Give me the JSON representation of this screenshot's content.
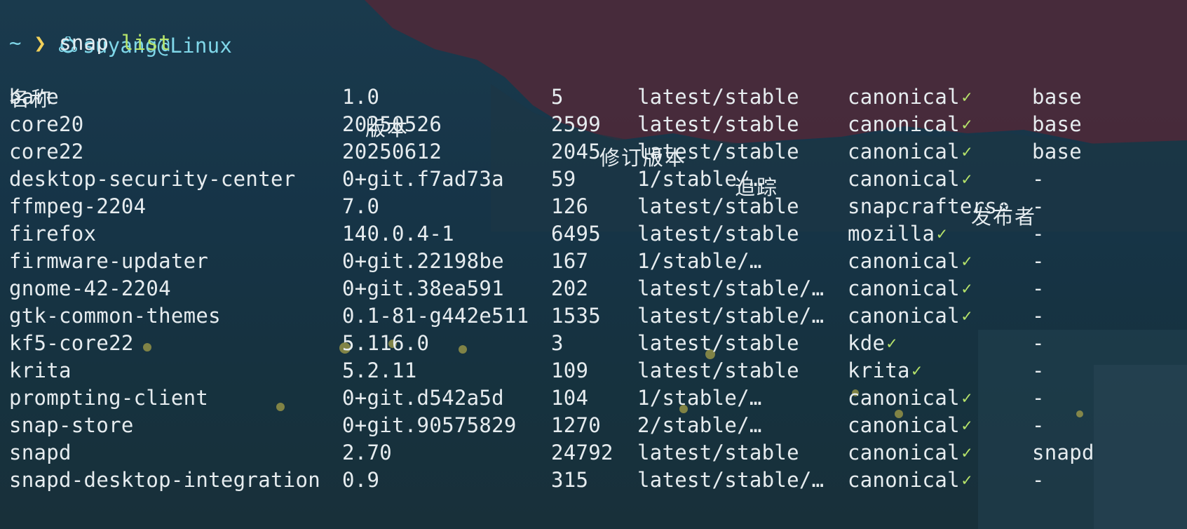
{
  "prompt": {
    "user_host": "suyang@Linux",
    "cwd": "~",
    "arrow": "❯",
    "command": "snap",
    "argument": "list"
  },
  "headers": [
    "名称",
    "版本",
    "修订版本",
    "追踪",
    "发布者"
  ],
  "rows": [
    {
      "name": "bare",
      "version": "1.0",
      "rev": "5",
      "tracking": "latest/stable",
      "publisher": "canonical",
      "badge": "✓",
      "notes": "base"
    },
    {
      "name": "core20",
      "version": "20250526",
      "rev": "2599",
      "tracking": "latest/stable",
      "publisher": "canonical",
      "badge": "✓",
      "notes": "base"
    },
    {
      "name": "core22",
      "version": "20250612",
      "rev": "2045",
      "tracking": "latest/stable",
      "publisher": "canonical",
      "badge": "✓",
      "notes": "base"
    },
    {
      "name": "desktop-security-center",
      "version": "0+git.f7ad73a",
      "rev": "59",
      "tracking": "1/stable/…",
      "publisher": "canonical",
      "badge": "✓",
      "notes": "-"
    },
    {
      "name": "ffmpeg-2204",
      "version": "7.0",
      "rev": "126",
      "tracking": "latest/stable",
      "publisher": "snapcrafters",
      "badge": "✪",
      "notes": "-"
    },
    {
      "name": "firefox",
      "version": "140.0.4-1",
      "rev": "6495",
      "tracking": "latest/stable",
      "publisher": "mozilla",
      "badge": "✓",
      "notes": "-"
    },
    {
      "name": "firmware-updater",
      "version": "0+git.22198be",
      "rev": "167",
      "tracking": "1/stable/…",
      "publisher": "canonical",
      "badge": "✓",
      "notes": "-"
    },
    {
      "name": "gnome-42-2204",
      "version": "0+git.38ea591",
      "rev": "202",
      "tracking": "latest/stable/…",
      "publisher": "canonical",
      "badge": "✓",
      "notes": "-"
    },
    {
      "name": "gtk-common-themes",
      "version": "0.1-81-g442e511",
      "rev": "1535",
      "tracking": "latest/stable/…",
      "publisher": "canonical",
      "badge": "✓",
      "notes": "-"
    },
    {
      "name": "kf5-core22",
      "version": "5.116.0",
      "rev": "3",
      "tracking": "latest/stable",
      "publisher": "kde",
      "badge": "✓",
      "notes": "-"
    },
    {
      "name": "krita",
      "version": "5.2.11",
      "rev": "109",
      "tracking": "latest/stable",
      "publisher": "krita",
      "badge": "✓",
      "notes": "-"
    },
    {
      "name": "prompting-client",
      "version": "0+git.d542a5d",
      "rev": "104",
      "tracking": "1/stable/…",
      "publisher": "canonical",
      "badge": "✓",
      "notes": "-"
    },
    {
      "name": "snap-store",
      "version": "0+git.90575829",
      "rev": "1270",
      "tracking": "2/stable/…",
      "publisher": "canonical",
      "badge": "✓",
      "notes": "-"
    },
    {
      "name": "snapd",
      "version": "2.70",
      "rev": "24792",
      "tracking": "latest/stable",
      "publisher": "canonical",
      "badge": "✓",
      "notes": "snapd"
    },
    {
      "name": "snapd-desktop-integration",
      "version": "0.9",
      "rev": "315",
      "tracking": "latest/stable/…",
      "publisher": "canonical",
      "badge": "✓",
      "notes": "-"
    }
  ],
  "colors": {
    "background": "#163447",
    "text": "#e6ecef",
    "prompt": "#7fd6e8",
    "arrow": "#f2d15a",
    "argument": "#b6e36a",
    "verified": "#b6e36a",
    "sky_maroon": "#4a2a3a",
    "lights": "#d8c64a"
  },
  "icons": [
    "os-logo-icon",
    "verified-check-icon",
    "star-badge-icon"
  ]
}
